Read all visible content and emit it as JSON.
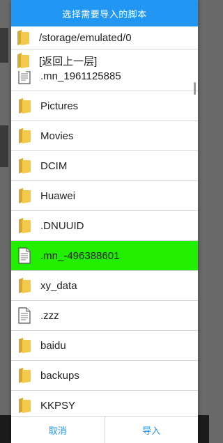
{
  "dialog": {
    "title": "选择需要导入的脚本",
    "path": "/storage/emulated/0",
    "up_label": "[返回上一层]"
  },
  "files": [
    {
      "name": ".mn_1961125885",
      "icon": "file-icon",
      "selected": false
    },
    {
      "name": "Pictures",
      "icon": "folder-icon",
      "selected": false
    },
    {
      "name": "Movies",
      "icon": "folder-icon",
      "selected": false
    },
    {
      "name": "DCIM",
      "icon": "folder-icon",
      "selected": false
    },
    {
      "name": "Huawei",
      "icon": "folder-icon",
      "selected": false
    },
    {
      "name": ".DNUUID",
      "icon": "folder-icon",
      "selected": false
    },
    {
      "name": ".mn_-496388601",
      "icon": "file-icon",
      "selected": true
    },
    {
      "name": "xy_data",
      "icon": "folder-icon",
      "selected": false
    },
    {
      "name": ".zzz",
      "icon": "file-icon",
      "selected": false
    },
    {
      "name": "baidu",
      "icon": "folder-icon",
      "selected": false
    },
    {
      "name": "backups",
      "icon": "folder-icon",
      "selected": false
    },
    {
      "name": "KKPSY",
      "icon": "folder-icon",
      "selected": false
    }
  ],
  "footer": {
    "cancel_label": "取消",
    "import_label": "导入"
  },
  "colors": {
    "title_bar": "#2196f3",
    "selected_row": "#22ee00",
    "folder": "#f2c94c"
  }
}
